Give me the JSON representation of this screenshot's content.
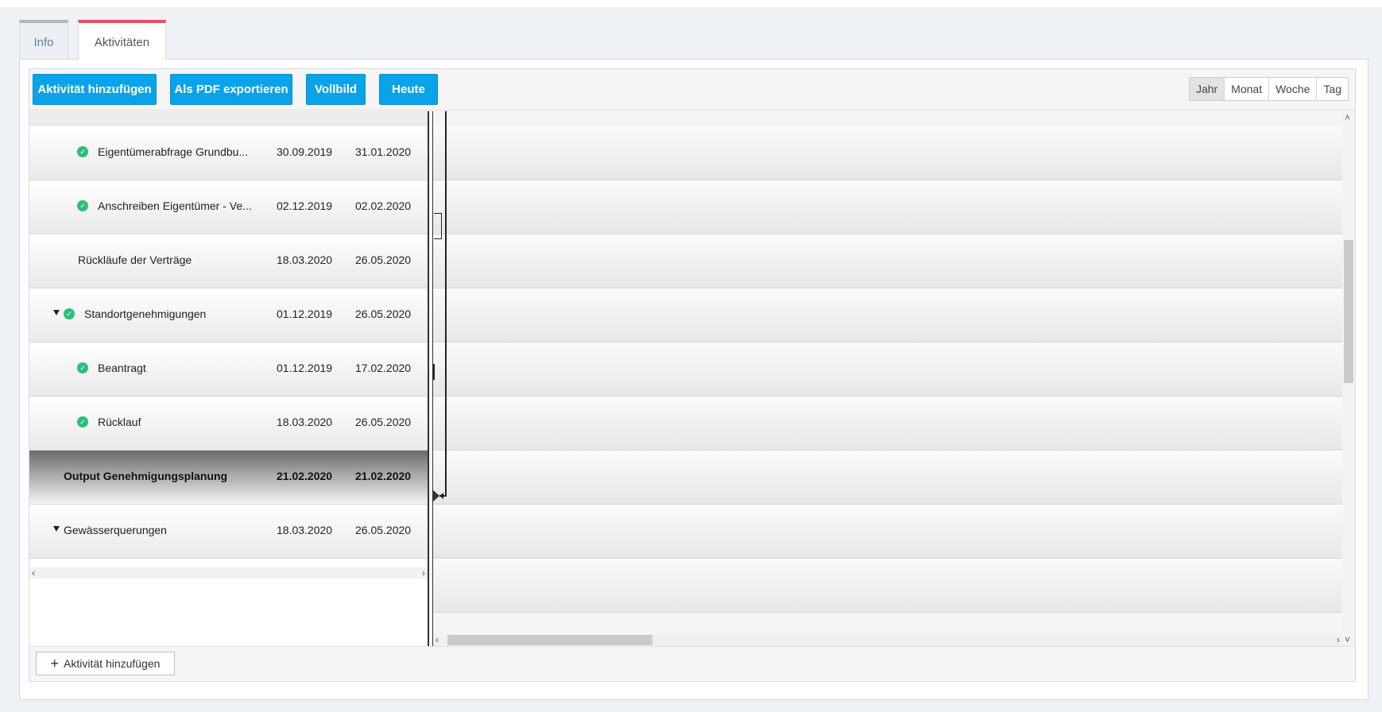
{
  "tabs": [
    {
      "label": "Info"
    },
    {
      "label": "Aktivitäten"
    }
  ],
  "toolbar": {
    "add_activity": "Aktivität hinzufügen",
    "export_pdf": "Als PDF exportieren",
    "fullscreen": "Vollbild",
    "today": "Heute",
    "scale_options": [
      "Jahr",
      "Monat",
      "Woche",
      "Tag"
    ],
    "scale_selected": "Jahr"
  },
  "colors": {
    "primary_button": "#0aa2e8",
    "active_tab_accent": "#e0535b",
    "status_done": "#2cbf7a"
  },
  "activities": [
    {
      "name": "Eigentümerabfrage Grundbu...",
      "start": "30.09.2019",
      "end": "31.01.2020",
      "done": true,
      "level": 2
    },
    {
      "name": "Anschreiben Eigentümer - Ve...",
      "start": "02.12.2019",
      "end": "02.02.2020",
      "done": true,
      "level": 2
    },
    {
      "name": "Rückläufe der Verträge",
      "start": "18.03.2020",
      "end": "26.05.2020",
      "done": false,
      "level": 2
    },
    {
      "name": "Standortgenehmigungen",
      "start": "01.12.2019",
      "end": "26.05.2020",
      "done": true,
      "level": 1,
      "expanded": true
    },
    {
      "name": "Beantragt",
      "start": "01.12.2019",
      "end": "17.02.2020",
      "done": true,
      "level": 2
    },
    {
      "name": "Rücklauf",
      "start": "18.03.2020",
      "end": "26.05.2020",
      "done": true,
      "level": 2
    },
    {
      "name": "Output Genehmigungsplanung",
      "start": "21.02.2020",
      "end": "21.02.2020",
      "done": false,
      "level": 0,
      "selected": true
    },
    {
      "name": "Gewässerquerungen",
      "start": "18.03.2020",
      "end": "26.05.2020",
      "done": false,
      "level": 1,
      "expanded": true
    }
  ],
  "icons": {
    "status": "check-circle-icon",
    "expand": "caret-down-icon",
    "add": "plus-icon"
  },
  "footer": {
    "add_activity": "Aktivität hinzufügen"
  }
}
